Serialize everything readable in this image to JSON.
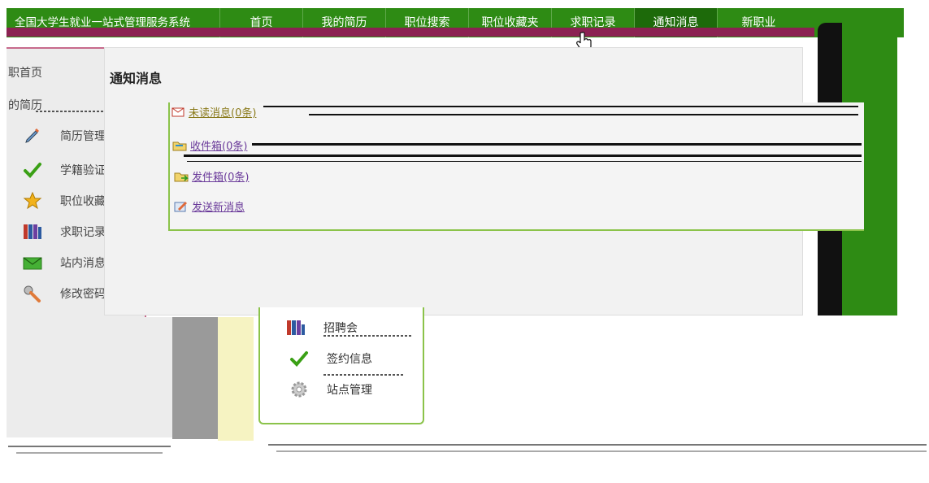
{
  "topbar": {
    "brand": "全国大学生就业一站式管理服务系统",
    "items": [
      {
        "label": "首页"
      },
      {
        "label": "我的简历"
      },
      {
        "label": "职位搜索"
      },
      {
        "label": "职位收藏夹"
      },
      {
        "label": "求职记录"
      },
      {
        "label": "通知消息"
      },
      {
        "label": "新职业"
      }
    ],
    "active_index": 5
  },
  "sidebar": {
    "home": "职首页",
    "resume": "的简历",
    "items": [
      {
        "label": "简历管理",
        "icon": "pencil-icon"
      },
      {
        "label": "学籍验证",
        "icon": "check-icon"
      },
      {
        "label": "职位收藏",
        "icon": "star-icon"
      },
      {
        "label": "求职记录",
        "icon": "binders-icon"
      },
      {
        "label": "站内消息",
        "icon": "envelope-icon"
      },
      {
        "label": "修改密码",
        "icon": "key-icon"
      }
    ]
  },
  "main": {
    "title": "通知消息",
    "links": [
      {
        "label": "未读消息(0条)",
        "icon": "envelope-icon"
      },
      {
        "label": "收件箱(0条)",
        "icon": "inbox-folder-icon"
      },
      {
        "label": "发件箱(0条)",
        "icon": "outbox-folder-icon"
      },
      {
        "label": "发送新消息",
        "icon": "compose-icon"
      }
    ]
  },
  "lower_menu": {
    "items": [
      {
        "label": "招聘会",
        "icon": "binders-icon"
      },
      {
        "label": "签约信息",
        "icon": "check-icon"
      },
      {
        "label": "站点管理",
        "icon": "gear-icon"
      }
    ]
  },
  "colors": {
    "nav_green": "#2e8b14",
    "accent_magenta": "#8b2252",
    "border_green": "#8bc34a",
    "link_olive": "#8a7a1a",
    "link_purple": "#6a3a9a"
  }
}
